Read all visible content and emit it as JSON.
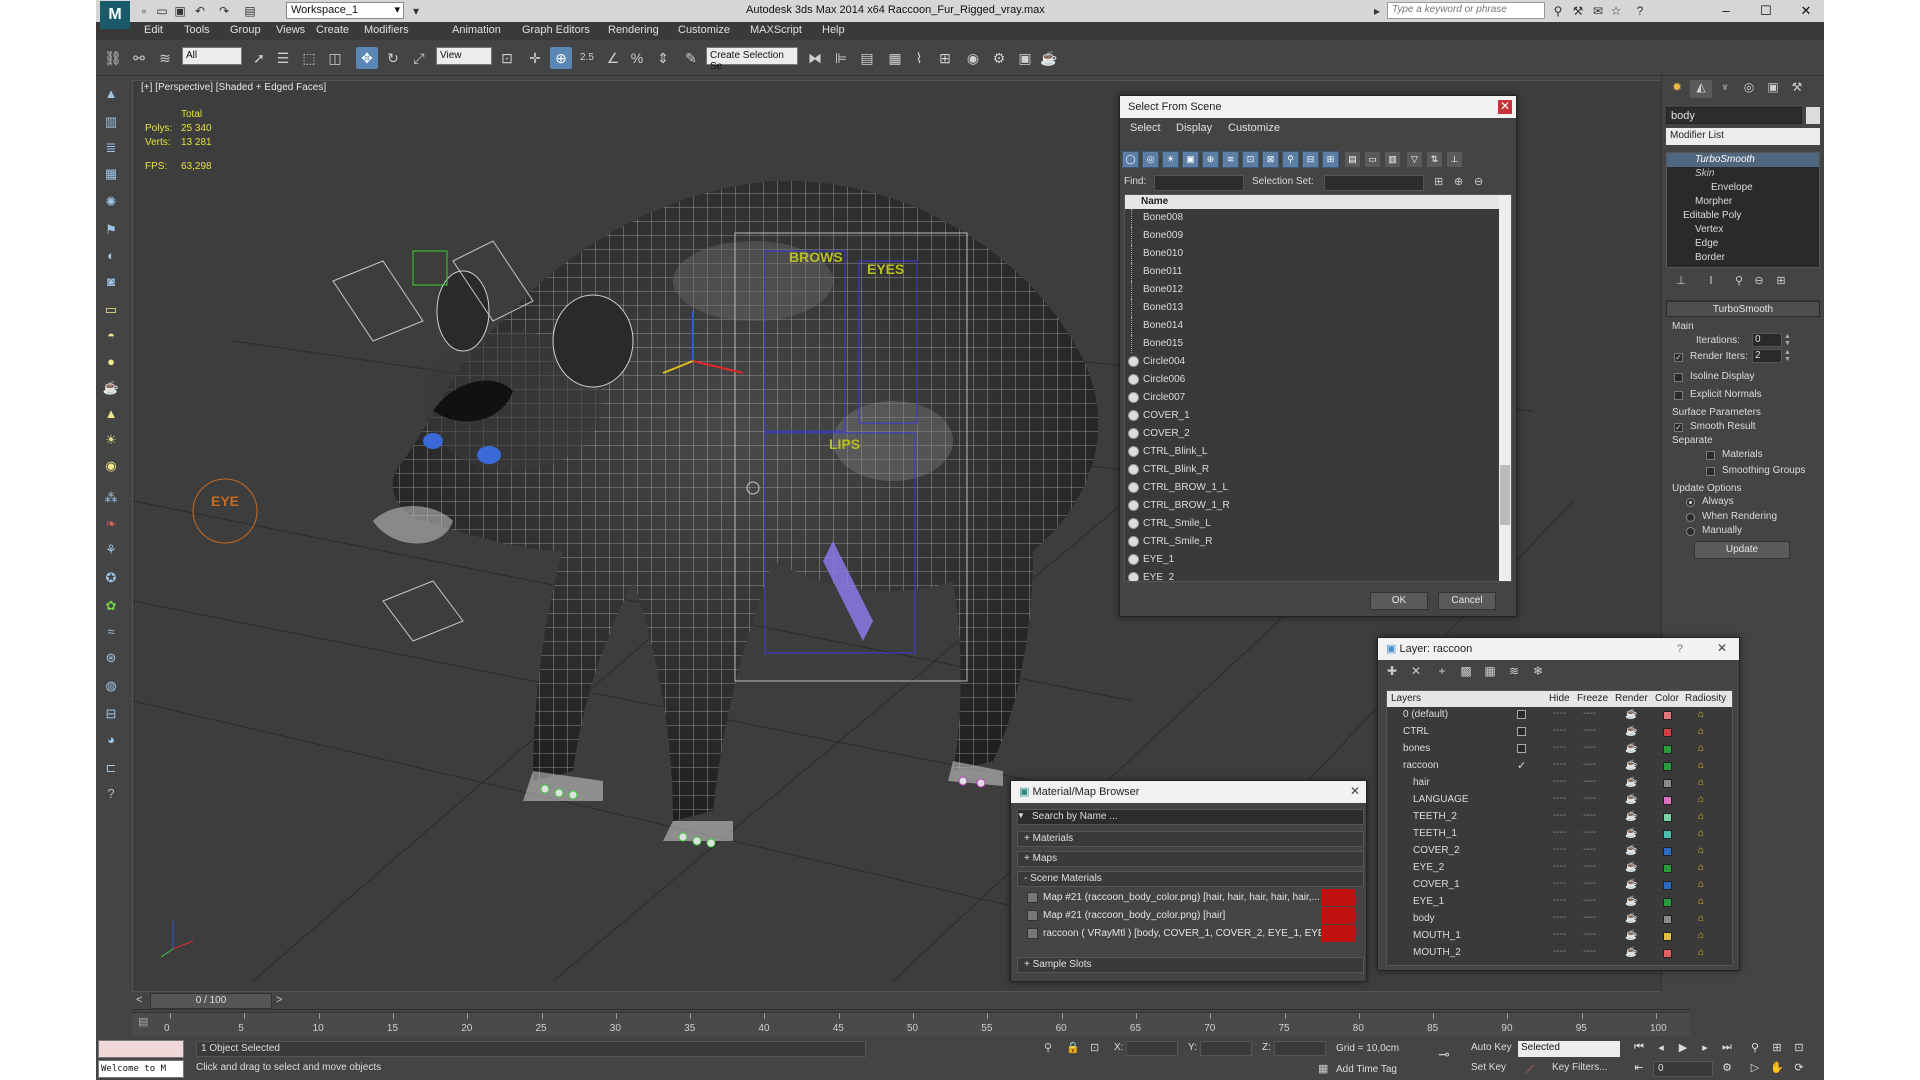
{
  "titlebar": {
    "workspace": "Workspace_1",
    "app_title": "Autodesk 3ds Max  2014 x64     Raccoon_Fur_Rigged_vray.max",
    "search_placeholder": "Type a keyword or phrase"
  },
  "menu": [
    "Edit",
    "Tools",
    "Group",
    "Views",
    "Create",
    "Modifiers",
    "Animation",
    "Graph Editors",
    "Rendering",
    "Customize",
    "MAXScript",
    "Help"
  ],
  "toolbar": {
    "selection_filter": "All",
    "ref_coord": "View",
    "snap_value": "2.5",
    "selection_set_placeholder": "Create Selection Se"
  },
  "viewport": {
    "label": "[+] [Perspective] [Shaded + Edged Faces]",
    "stats": {
      "total_label": "Total",
      "polys_label": "Polys:",
      "polys": "25 340",
      "verts_label": "Verts:",
      "verts": "13 281",
      "fps_label": "FPS:",
      "fps": "63,298"
    },
    "scene_labels": {
      "brows": "BROWS",
      "eyes": "EYES",
      "lips": "LIPS",
      "eye": "EYE"
    }
  },
  "command_panel": {
    "object_name": "body",
    "modifier_list": "Modifier List",
    "stack": [
      {
        "label": "TurboSmooth",
        "style": "sel"
      },
      {
        "label": "Skin",
        "style": "dim"
      },
      {
        "label": "Envelope",
        "style": "sub"
      },
      {
        "label": "Morpher",
        "style": "norm"
      },
      {
        "label": "Editable Poly",
        "style": "norm"
      },
      {
        "label": "Vertex",
        "style": "sub"
      },
      {
        "label": "Edge",
        "style": "sub"
      },
      {
        "label": "Border",
        "style": "sub"
      }
    ],
    "turbosmooth": {
      "title": "TurboSmooth",
      "main": "Main",
      "iterations_label": "Iterations:",
      "iterations": "0",
      "render_iters_label": "Render Iters:",
      "render_iters": "2",
      "isoline": "Isoline Display",
      "explicit_normals": "Explicit Normals",
      "surface_params": "Surface Parameters",
      "smooth_result": "Smooth Result",
      "separate": "Separate",
      "materials": "Materials",
      "smoothing_groups": "Smoothing Groups",
      "update_options": "Update Options",
      "always": "Always",
      "when_rendering": "When Rendering",
      "manually": "Manually",
      "update": "Update"
    }
  },
  "select_from_scene": {
    "title": "Select From Scene",
    "menu": [
      "Select",
      "Display",
      "Customize"
    ],
    "find_label": "Find:",
    "selection_set_label": "Selection Set:",
    "column_name": "Name",
    "rows": [
      "Bone008",
      "Bone009",
      "Bone010",
      "Bone011",
      "Bone012",
      "Bone013",
      "Bone014",
      "Bone015",
      "Circle004",
      "Circle006",
      "Circle007",
      "COVER_1",
      "COVER_2",
      "CTRL_Blink_L",
      "CTRL_Blink_R",
      "CTRL_BROW_1_L",
      "CTRL_BROW_1_R",
      "CTRL_Smile_L",
      "CTRL_Smile_R",
      "EYE_1",
      "EYE_2"
    ],
    "ok": "OK",
    "cancel": "Cancel"
  },
  "layer_dialog": {
    "title": "Layer: raccoon",
    "columns": [
      "Layers",
      "Hide",
      "Freeze",
      "Render",
      "Color",
      "Radiosity"
    ],
    "rows": [
      {
        "name": "0 (default)",
        "indent": 0,
        "color": "#e07a7a",
        "check": "box"
      },
      {
        "name": "CTRL",
        "indent": 0,
        "color": "#d04040",
        "check": "box"
      },
      {
        "name": "bones",
        "indent": 0,
        "color": "#2a9a3a",
        "check": "box"
      },
      {
        "name": "raccoon",
        "indent": 0,
        "color": "#2a9a3a",
        "check": "tick"
      },
      {
        "name": "hair",
        "indent": 1,
        "color": "#8a8a8a",
        "check": ""
      },
      {
        "name": "LANGUAGE",
        "indent": 1,
        "color": "#e070c0",
        "check": ""
      },
      {
        "name": "TEETH_2",
        "indent": 1,
        "color": "#7ad0a0",
        "check": ""
      },
      {
        "name": "TEETH_1",
        "indent": 1,
        "color": "#4ac0b0",
        "check": ""
      },
      {
        "name": "COVER_2",
        "indent": 1,
        "color": "#2a6ac0",
        "check": ""
      },
      {
        "name": "EYE_2",
        "indent": 1,
        "color": "#2a9a3a",
        "check": ""
      },
      {
        "name": "COVER_1",
        "indent": 1,
        "color": "#2a6ac0",
        "check": ""
      },
      {
        "name": "EYE_1",
        "indent": 1,
        "color": "#2a9a3a",
        "check": ""
      },
      {
        "name": "body",
        "indent": 1,
        "color": "#8a8a8a",
        "check": ""
      },
      {
        "name": "MOUTH_1",
        "indent": 1,
        "color": "#e0c040",
        "check": ""
      },
      {
        "name": "MOUTH_2",
        "indent": 1,
        "color": "#e06060",
        "check": ""
      }
    ]
  },
  "material_browser": {
    "title": "Material/Map Browser",
    "search_placeholder": "Search by Name ...",
    "sections": [
      "+ Materials",
      "+ Maps",
      "- Scene Materials",
      "+ Sample Slots"
    ],
    "items": [
      "Map #21 (raccoon_body_color.png)  [hair, hair, hair, hair, hair,...",
      "Map #21 (raccoon_body_color.png)  [hair]",
      "raccoon  ( VRayMtl )  [body, COVER_1, COVER_2, EYE_1, EYE_2..."
    ]
  },
  "timeline": {
    "slider": "0 / 100",
    "ticks": [
      "0",
      "5",
      "10",
      "15",
      "20",
      "25",
      "30",
      "35",
      "40",
      "45",
      "50",
      "55",
      "60",
      "65",
      "70",
      "75",
      "80",
      "85",
      "90",
      "95",
      "100"
    ]
  },
  "status": {
    "welcome": "Welcome to M",
    "object_selected": "1 Object Selected",
    "prompt": "Click and drag to select and move objects",
    "x_label": "X:",
    "y_label": "Y:",
    "z_label": "Z:",
    "grid": "Grid = 10,0cm",
    "add_time_tag": "Add Time Tag",
    "auto_key": "Auto Key",
    "set_key": "Set Key",
    "selected": "Selected",
    "key_filters": "Key Filters...",
    "frame": "0"
  }
}
